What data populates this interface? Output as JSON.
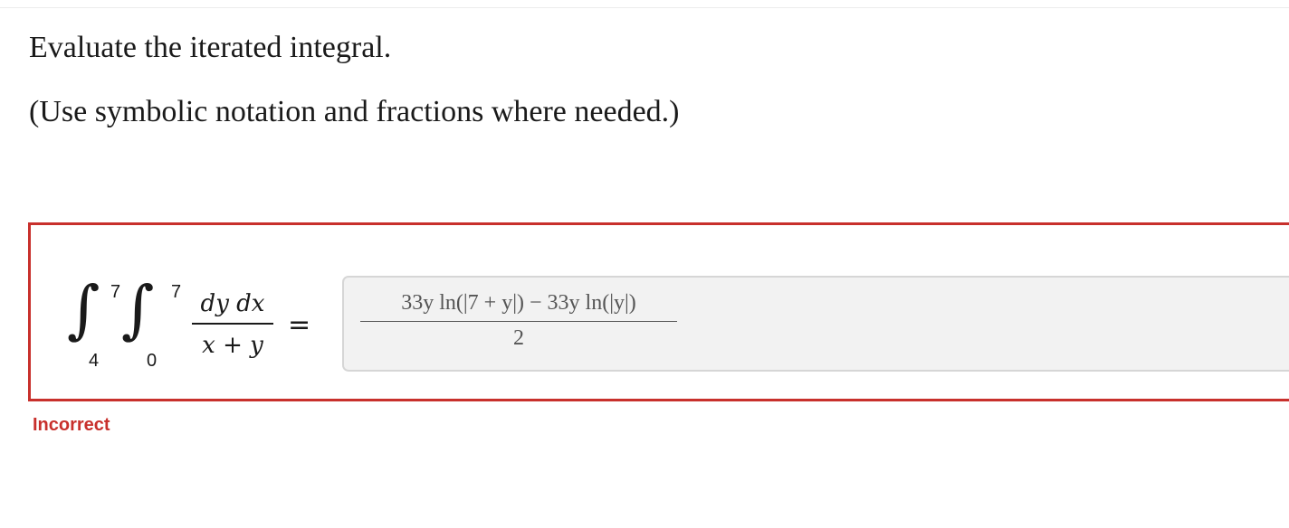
{
  "question": {
    "prompt": "Evaluate the iterated integral.",
    "hint": "(Use symbolic notation and fractions where needed.)"
  },
  "integral": {
    "outer_upper": "7",
    "outer_lower": "4",
    "inner_upper": "7",
    "inner_lower": "0",
    "numerator": "dy dx",
    "denominator": "x + y",
    "equals": "="
  },
  "answer": {
    "numerator": "33y ln(|7 + y|) − 33y ln(|y|)",
    "denominator": "2"
  },
  "feedback": {
    "status": "Incorrect",
    "status_color": "#c8302c"
  }
}
